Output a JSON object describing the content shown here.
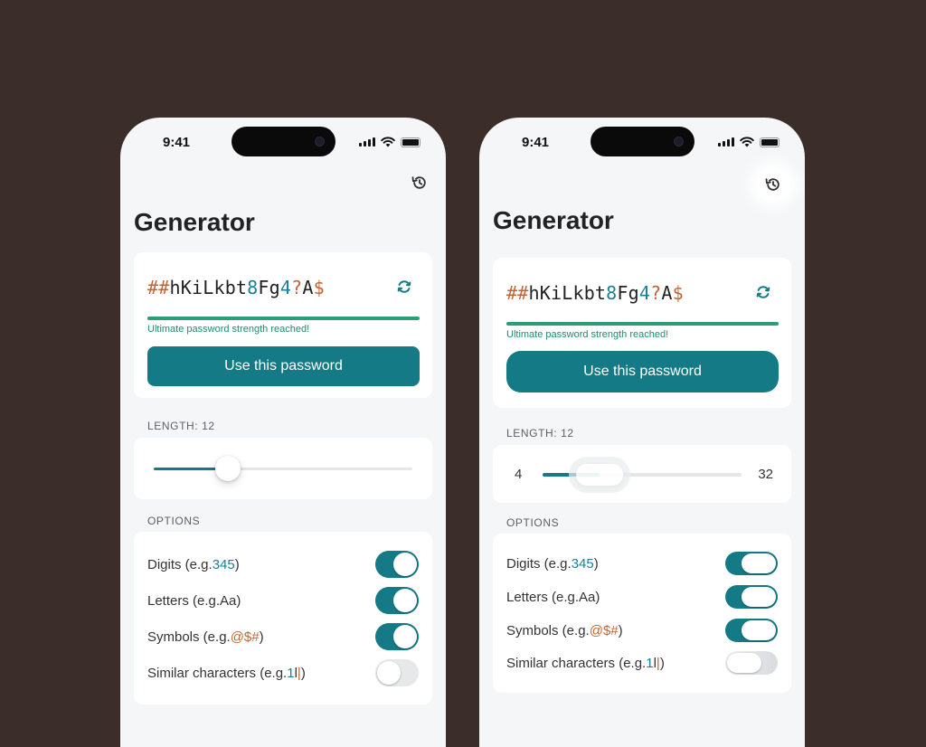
{
  "status_bar": {
    "time": "9:41"
  },
  "screen": {
    "title": "Generator",
    "password": {
      "p1": "##",
      "p2": "hKiLkbt",
      "p3": "8",
      "p4": "Fg",
      "p5": "4",
      "p6": "?",
      "p7": "A",
      "p8": "$"
    },
    "strength_text": "Ultimate password strength reached!",
    "strength_fraction": 1.0,
    "use_button": "Use this password",
    "length_label": "LENGTH: 12",
    "length_value": 12,
    "slider_min": "4",
    "slider_max": "32",
    "options_label": "OPTIONS",
    "options": [
      {
        "label": "Digits (e.g.",
        "example": "345",
        "suffix": ")",
        "enabled": true
      },
      {
        "label": "Letters (e.g.Aa)",
        "enabled": true
      },
      {
        "label": "Symbols (e.g.",
        "example": "@$#",
        "suffix": ")",
        "enabled": true
      },
      {
        "label": "Similar characters (e.g.",
        "ex1": "1",
        "ex2": "l",
        "ex3": "|",
        "suffix": ")",
        "enabled": false
      }
    ]
  },
  "colors": {
    "background": "#3b2d29",
    "accent": "#147a86",
    "strength": "#2d9d78",
    "symbol": "#c06535",
    "digit": "#1b7f98"
  },
  "icons": [
    "history-icon",
    "refresh-icon"
  ]
}
